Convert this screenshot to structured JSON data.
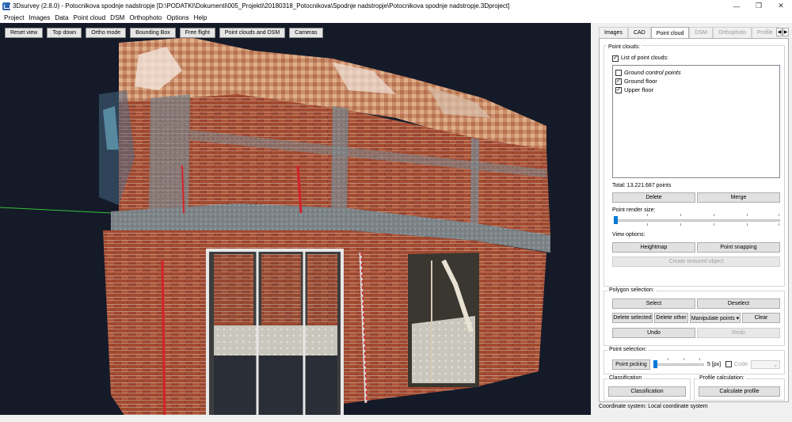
{
  "window": {
    "title": "3Dsurvey (2.8.0) - Potocnikova spodnje nadstropje [D:\\PODATKI\\Dokumenti\\005_Projekti\\20180318_Potocnikova\\Spodnje nadstropje\\Potocnikova spodnje nadstropje.3Dproject]",
    "minimize": "—",
    "maximize": "❐",
    "close": "✕",
    "icon": "3dsurvey-app-icon"
  },
  "menu": [
    "Project",
    "Images",
    "Data",
    "Point cloud",
    "DSM",
    "Orthophoto",
    "Options",
    "Help"
  ],
  "viewport_toolbar": [
    "Reset view",
    "Top down",
    "Ortho mode",
    "Bounding Box",
    "Free flight",
    "Point clouds and DSM",
    "Cameras"
  ],
  "tabs": [
    "Images",
    "CAD",
    "Point cloud",
    "DSM",
    "Orthophoto",
    "Profile"
  ],
  "tab_scroll": {
    "left": "◀",
    "right": "▶"
  },
  "point_clouds": {
    "group_title": "Point clouds:",
    "list_checkbox_label": "List of point clouds:",
    "list_checkbox_checked": "✓",
    "items": [
      {
        "label": "Ground control points",
        "check": ""
      },
      {
        "label": "Ground floor",
        "check": "✓"
      },
      {
        "label": "Upper floor",
        "check": "✓"
      }
    ],
    "total": "Total: 13.221.687 points",
    "delete_label": "Delete",
    "merge_label": "Merge",
    "render_size_label": "Point render size:",
    "view_options_label": "View options:",
    "heightmap_label": "Heightmap",
    "snapping_label": "Point snapping",
    "textured_label": "Create textured object",
    "render_size_level": 0.0
  },
  "polygon_selection": {
    "title": "Polygon selection:",
    "select": "Select",
    "deselect": "Deselect",
    "delete_selected": "Delete selected",
    "delete_other": "Delete other",
    "manipulate": "Manipulate points ▾",
    "clear": "Clear",
    "undo": "Undo",
    "redo": "Redo"
  },
  "point_selection": {
    "title": "Point selection:",
    "picking": "Point picking",
    "size_value": "5 [px]",
    "code_label": "Code:",
    "code_value": "⌄",
    "slider_level": 0.0
  },
  "classification": {
    "title": "Classification",
    "button": "Classification"
  },
  "profile": {
    "title": "Profile calculation:",
    "button": "Calculate profile"
  },
  "status": {
    "coordinate_system": "Coordinate system: Local coordinate system"
  }
}
